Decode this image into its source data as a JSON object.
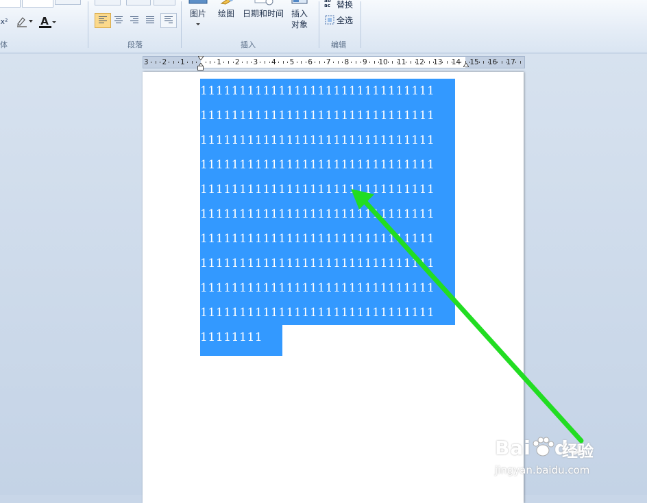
{
  "ribbon": {
    "groups": {
      "font_partial": "体",
      "paragraph": "段落",
      "insert": "插入",
      "edit": "编辑"
    },
    "font": {
      "superscript": "x²",
      "font_color_glyph": "A"
    },
    "insert_buttons": {
      "picture": "图片",
      "drawing": "绘图",
      "datetime": "日期和时间",
      "object_line1": "插入",
      "object_line2": "对象"
    },
    "edit_buttons": {
      "replace": "替换",
      "replace_icon_text": "ab→ac",
      "select_all": "全选"
    }
  },
  "ruler": {
    "labels": [
      "3",
      "2",
      "1",
      "1",
      "2",
      "3",
      "4",
      "5",
      "6",
      "7",
      "8",
      "9",
      "10",
      "11",
      "12",
      "13",
      "14",
      "15",
      "16",
      "17"
    ]
  },
  "document": {
    "lines": [
      "111111111111111111111111111111",
      "111111111111111111111111111111",
      "111111111111111111111111111111",
      "111111111111111111111111111111",
      "111111111111111111111111111111",
      "111111111111111111111111111111",
      "111111111111111111111111111111",
      "111111111111111111111111111111",
      "111111111111111111111111111111",
      "111111111111111111111111111111",
      "11111111"
    ],
    "selection_color": "#3399ff"
  },
  "annotation": {
    "arrow_color": "#22dd22"
  },
  "watermark": {
    "brand": "Bai",
    "brand2": "du",
    "suffix": "经验",
    "url": "jingyan.baidu.com"
  }
}
